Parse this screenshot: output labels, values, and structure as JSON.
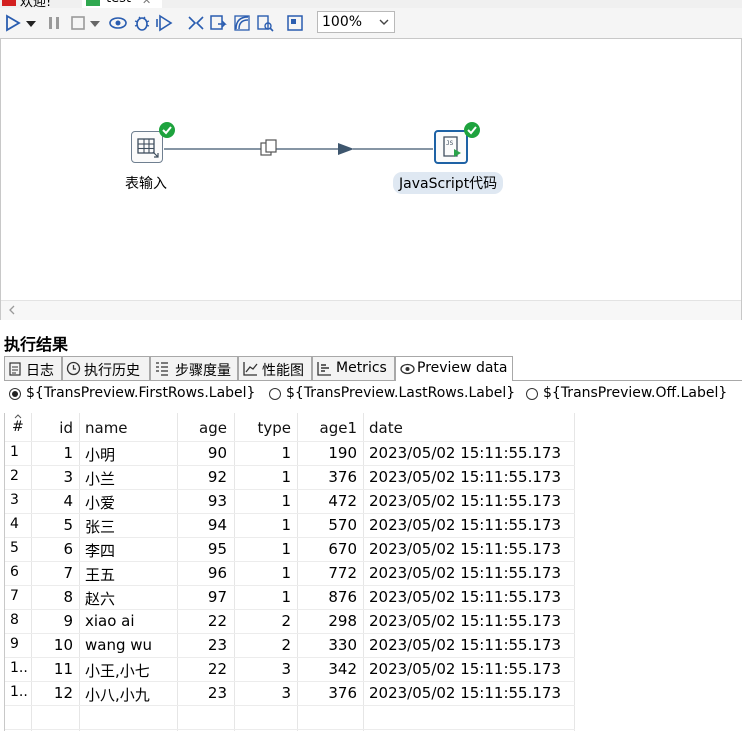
{
  "editor_tabs": [
    {
      "label": "欢迎!"
    },
    {
      "label": "test"
    }
  ],
  "toolbar": {
    "zoom": "100%"
  },
  "canvas": {
    "steps": [
      {
        "label": "表输入"
      },
      {
        "label": "JavaScript代码"
      }
    ]
  },
  "results": {
    "title": "执行结果",
    "tabs": [
      {
        "label": "日志"
      },
      {
        "label": "执行历史"
      },
      {
        "label": "步骤度量"
      },
      {
        "label": "性能图"
      },
      {
        "label": "Metrics"
      },
      {
        "label": "Preview data"
      }
    ],
    "preview_options": [
      {
        "label": "${TransPreview.FirstRows.Label}",
        "selected": true
      },
      {
        "label": "${TransPreview.LastRows.Label}",
        "selected": false
      },
      {
        "label": "${TransPreview.Off.Label}",
        "selected": false
      }
    ]
  },
  "table": {
    "columns": [
      "#",
      "id",
      "name",
      "age",
      "type",
      "age1",
      "date"
    ],
    "rows": [
      [
        "1",
        "1",
        "小明",
        "90",
        "1",
        "190",
        "2023/05/02 15:11:55.173"
      ],
      [
        "2",
        "3",
        "小兰",
        "92",
        "1",
        "376",
        "2023/05/02 15:11:55.173"
      ],
      [
        "3",
        "4",
        "小爱",
        "93",
        "1",
        "472",
        "2023/05/02 15:11:55.173"
      ],
      [
        "4",
        "5",
        "张三",
        "94",
        "1",
        "570",
        "2023/05/02 15:11:55.173"
      ],
      [
        "5",
        "6",
        "李四",
        "95",
        "1",
        "670",
        "2023/05/02 15:11:55.173"
      ],
      [
        "6",
        "7",
        "王五",
        "96",
        "1",
        "772",
        "2023/05/02 15:11:55.173"
      ],
      [
        "7",
        "8",
        "赵六",
        "97",
        "1",
        "876",
        "2023/05/02 15:11:55.173"
      ],
      [
        "8",
        "9",
        "xiao ai",
        "22",
        "2",
        "298",
        "2023/05/02 15:11:55.173"
      ],
      [
        "9",
        "10",
        "wang wu",
        "23",
        "2",
        "330",
        "2023/05/02 15:11:55.173"
      ],
      [
        "1..",
        "11",
        "小王,小七",
        "22",
        "3",
        "342",
        "2023/05/02 15:11:55.173"
      ],
      [
        "1..",
        "12",
        "小八,小九",
        "23",
        "3",
        "376",
        "2023/05/02 15:11:55.173"
      ]
    ]
  }
}
